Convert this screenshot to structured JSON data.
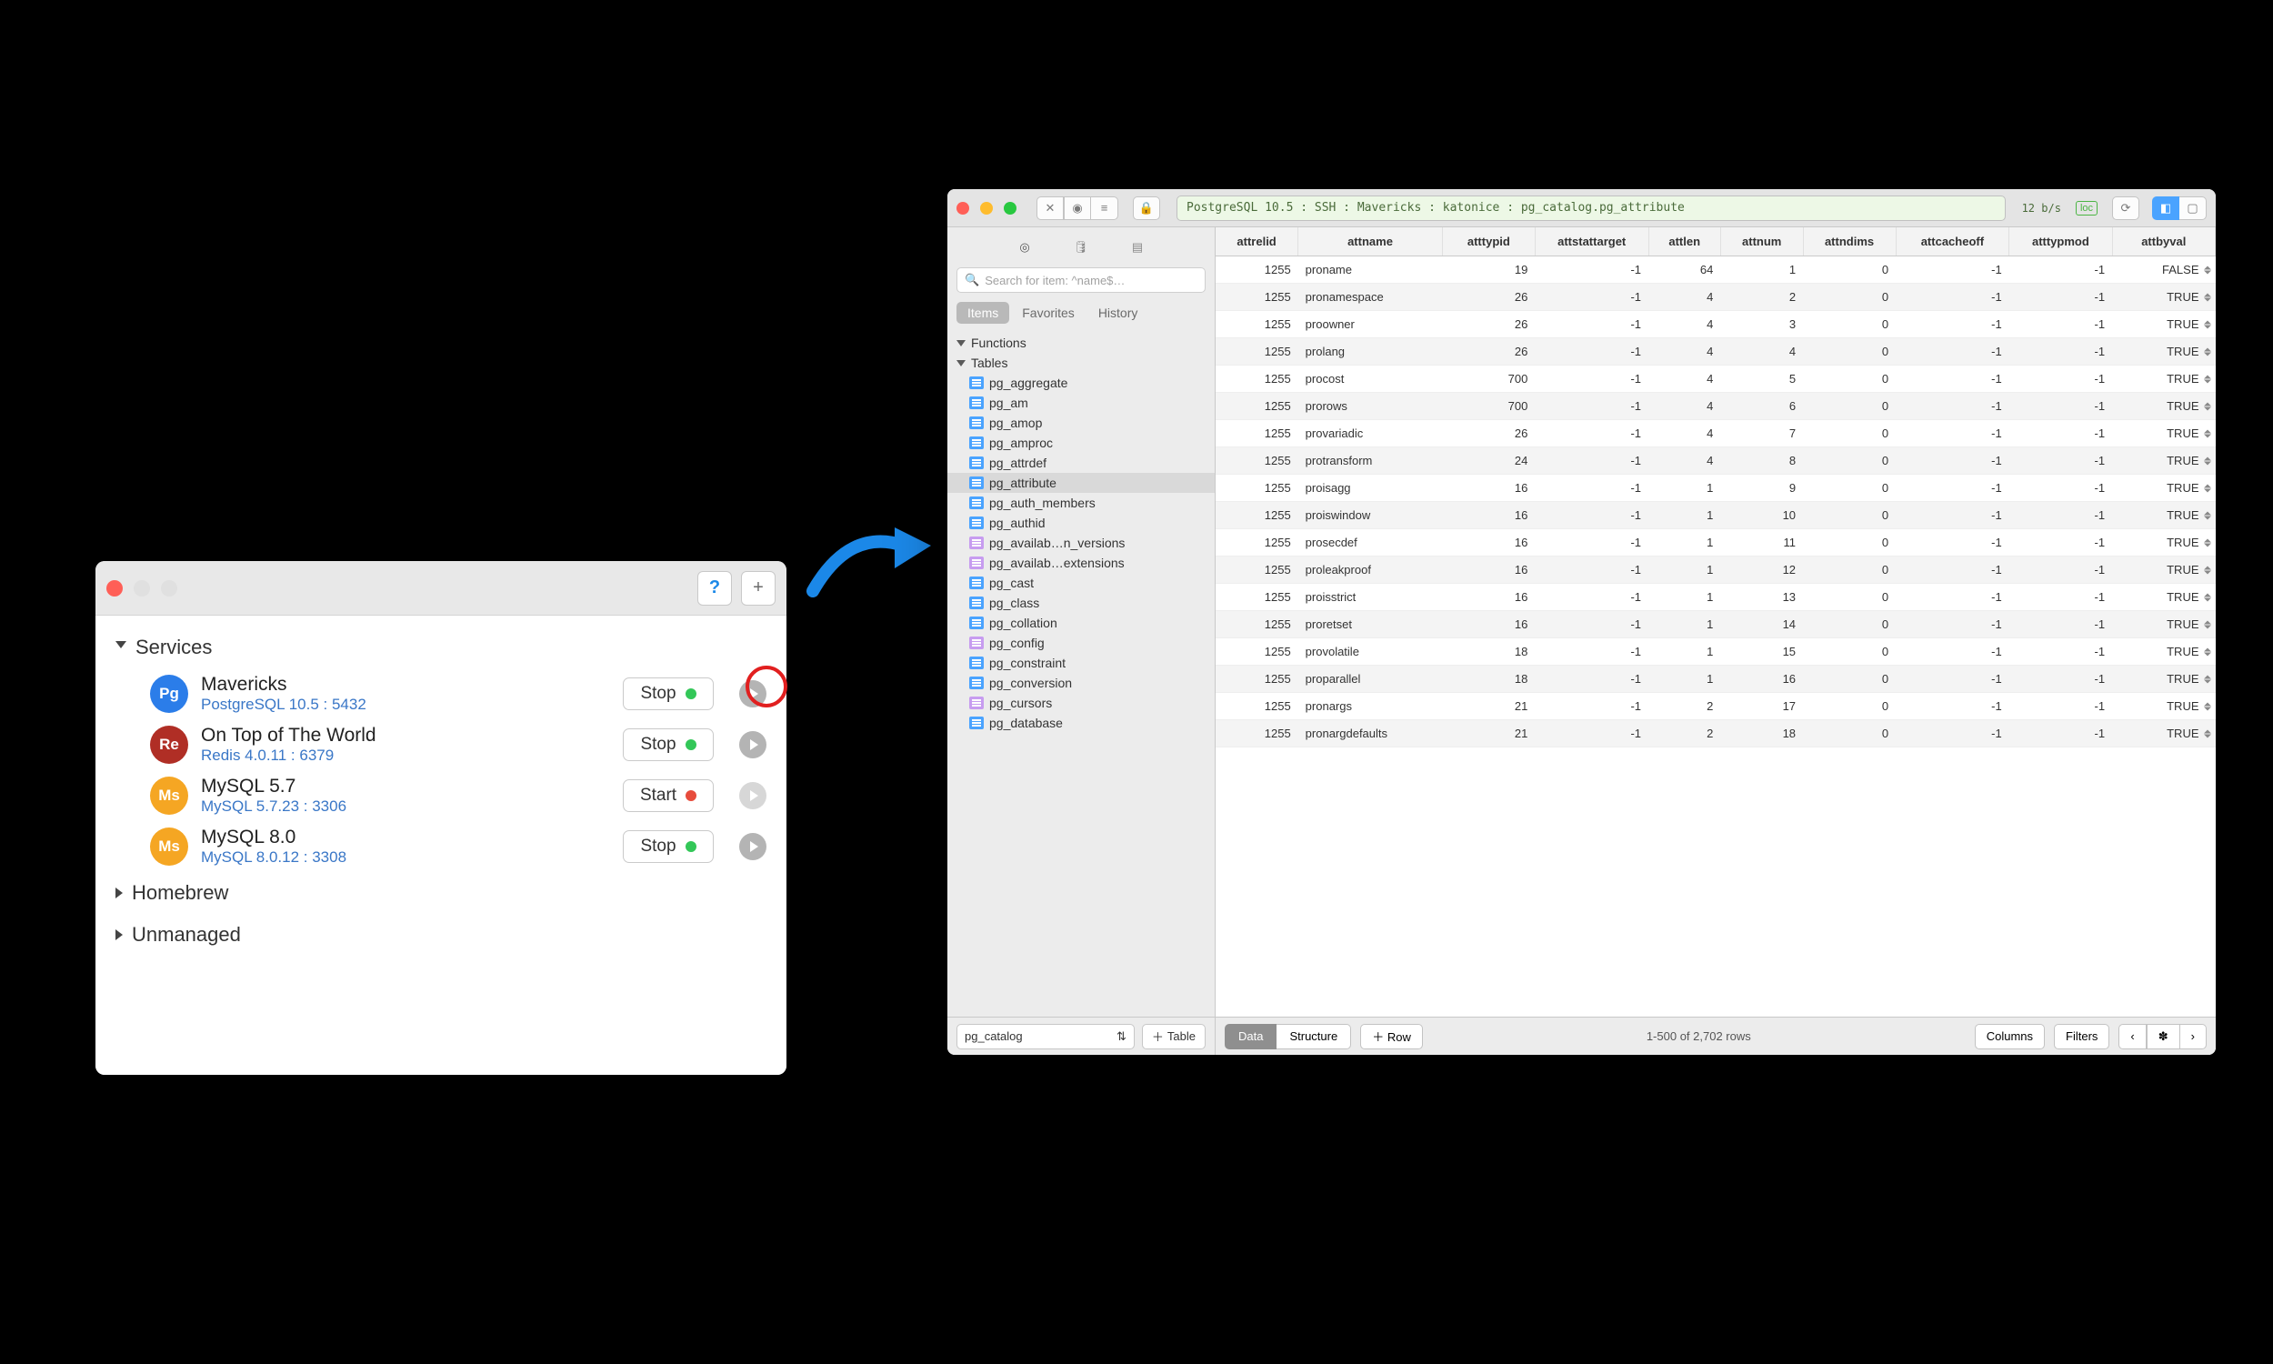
{
  "services_window": {
    "help_label": "?",
    "add_label": "+",
    "groups": [
      {
        "name": "Services",
        "open": true
      },
      {
        "name": "Homebrew",
        "open": false
      },
      {
        "name": "Unmanaged",
        "open": false
      }
    ],
    "services": [
      {
        "badge": "Pg",
        "badge_class": "pg",
        "name": "Mavericks",
        "sub": "PostgreSQL 10.5 : 5432",
        "action": "Stop",
        "status": "green",
        "go_disabled": false,
        "highlighted": true
      },
      {
        "badge": "Re",
        "badge_class": "re",
        "name": "On Top of The World",
        "sub": "Redis 4.0.11 : 6379",
        "action": "Stop",
        "status": "green",
        "go_disabled": false
      },
      {
        "badge": "Ms",
        "badge_class": "ms",
        "name": "MySQL 5.7",
        "sub": "MySQL 5.7.23 : 3306",
        "action": "Start",
        "status": "red",
        "go_disabled": true
      },
      {
        "badge": "Ms",
        "badge_class": "ms",
        "name": "MySQL 8.0",
        "sub": "MySQL 8.0.12 : 3308",
        "action": "Stop",
        "status": "green",
        "go_disabled": false
      }
    ]
  },
  "db_window": {
    "breadcrumb": "PostgreSQL 10.5 : SSH : Mavericks : katonice : pg_catalog.pg_attribute",
    "net_rate": "12 b/s",
    "loc_badge": "loc",
    "sidebar": {
      "search_placeholder": "Search for item: ^name$…",
      "subtabs": [
        "Items",
        "Favorites",
        "History"
      ],
      "groups": [
        {
          "label": "Functions",
          "children": []
        },
        {
          "label": "Tables",
          "children": [
            {
              "n": "pg_aggregate",
              "t": "t"
            },
            {
              "n": "pg_am",
              "t": "t"
            },
            {
              "n": "pg_amop",
              "t": "t"
            },
            {
              "n": "pg_amproc",
              "t": "t"
            },
            {
              "n": "pg_attrdef",
              "t": "t"
            },
            {
              "n": "pg_attribute",
              "t": "t",
              "sel": true
            },
            {
              "n": "pg_auth_members",
              "t": "t"
            },
            {
              "n": "pg_authid",
              "t": "t"
            },
            {
              "n": "pg_availab…n_versions",
              "t": "v"
            },
            {
              "n": "pg_availab…extensions",
              "t": "v"
            },
            {
              "n": "pg_cast",
              "t": "t"
            },
            {
              "n": "pg_class",
              "t": "t"
            },
            {
              "n": "pg_collation",
              "t": "t"
            },
            {
              "n": "pg_config",
              "t": "v"
            },
            {
              "n": "pg_constraint",
              "t": "t"
            },
            {
              "n": "pg_conversion",
              "t": "t"
            },
            {
              "n": "pg_cursors",
              "t": "v"
            },
            {
              "n": "pg_database",
              "t": "t"
            }
          ]
        }
      ],
      "schema_selector": "pg_catalog",
      "add_table_label": "Table"
    },
    "columns": [
      "attrelid",
      "attname",
      "atttypid",
      "attstattarget",
      "attlen",
      "attnum",
      "attndims",
      "attcacheoff",
      "atttypmod",
      "attbyval"
    ],
    "rows": [
      [
        1255,
        "proname",
        19,
        -1,
        64,
        1,
        0,
        -1,
        -1,
        "FALSE"
      ],
      [
        1255,
        "pronamespace",
        26,
        -1,
        4,
        2,
        0,
        -1,
        -1,
        "TRUE"
      ],
      [
        1255,
        "proowner",
        26,
        -1,
        4,
        3,
        0,
        -1,
        -1,
        "TRUE"
      ],
      [
        1255,
        "prolang",
        26,
        -1,
        4,
        4,
        0,
        -1,
        -1,
        "TRUE"
      ],
      [
        1255,
        "procost",
        700,
        -1,
        4,
        5,
        0,
        -1,
        -1,
        "TRUE"
      ],
      [
        1255,
        "prorows",
        700,
        -1,
        4,
        6,
        0,
        -1,
        -1,
        "TRUE"
      ],
      [
        1255,
        "provariadic",
        26,
        -1,
        4,
        7,
        0,
        -1,
        -1,
        "TRUE"
      ],
      [
        1255,
        "protransform",
        24,
        -1,
        4,
        8,
        0,
        -1,
        -1,
        "TRUE"
      ],
      [
        1255,
        "proisagg",
        16,
        -1,
        1,
        9,
        0,
        -1,
        -1,
        "TRUE"
      ],
      [
        1255,
        "proiswindow",
        16,
        -1,
        1,
        10,
        0,
        -1,
        -1,
        "TRUE"
      ],
      [
        1255,
        "prosecdef",
        16,
        -1,
        1,
        11,
        0,
        -1,
        -1,
        "TRUE"
      ],
      [
        1255,
        "proleakproof",
        16,
        -1,
        1,
        12,
        0,
        -1,
        -1,
        "TRUE"
      ],
      [
        1255,
        "proisstrict",
        16,
        -1,
        1,
        13,
        0,
        -1,
        -1,
        "TRUE"
      ],
      [
        1255,
        "proretset",
        16,
        -1,
        1,
        14,
        0,
        -1,
        -1,
        "TRUE"
      ],
      [
        1255,
        "provolatile",
        18,
        -1,
        1,
        15,
        0,
        -1,
        -1,
        "TRUE"
      ],
      [
        1255,
        "proparallel",
        18,
        -1,
        1,
        16,
        0,
        -1,
        -1,
        "TRUE"
      ],
      [
        1255,
        "pronargs",
        21,
        -1,
        2,
        17,
        0,
        -1,
        -1,
        "TRUE"
      ],
      [
        1255,
        "pronargdefaults",
        21,
        -1,
        2,
        18,
        0,
        -1,
        -1,
        "TRUE"
      ]
    ],
    "footer": {
      "seg": [
        "Data",
        "Structure"
      ],
      "add_row": "Row",
      "status": "1-500 of 2,702 rows",
      "columns_btn": "Columns",
      "filters_btn": "Filters"
    }
  }
}
